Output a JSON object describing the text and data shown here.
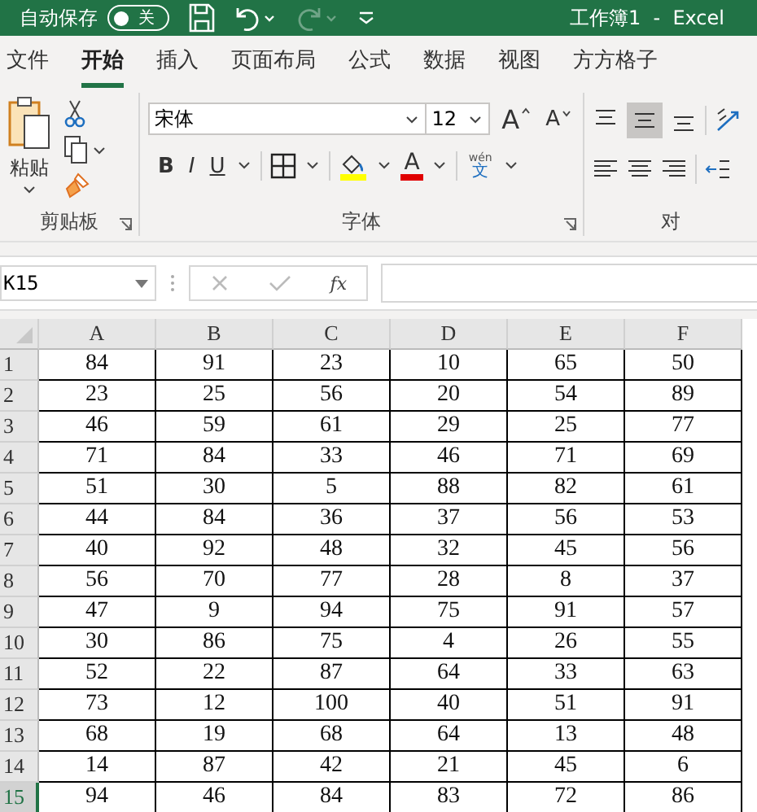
{
  "title_bar": {
    "autosave_label": "自动保存",
    "autosave_toggle": {
      "on": false,
      "label": "关"
    },
    "redo_disabled": true,
    "title": "工作簿1  -  Excel"
  },
  "tabs": [
    {
      "label": "文件",
      "selected": false
    },
    {
      "label": "开始",
      "selected": true
    },
    {
      "label": "插入",
      "selected": false
    },
    {
      "label": "页面布局",
      "selected": false
    },
    {
      "label": "公式",
      "selected": false
    },
    {
      "label": "数据",
      "selected": false
    },
    {
      "label": "视图",
      "selected": false
    },
    {
      "label": "方方格子",
      "selected": false
    }
  ],
  "ribbon": {
    "paste_label": "粘贴",
    "font_name": "宋体",
    "font_size": "12",
    "grow_font": "A",
    "shrink_font": "A",
    "bold": "B",
    "italic": "I",
    "underline": "U",
    "font_color": "A",
    "phonetic_top": "wén",
    "phonetic_bottom": "文",
    "groups": [
      "剪贴板",
      "字体",
      "对"
    ]
  },
  "formula_bar": {
    "name_box": "K15",
    "fx": "fx"
  },
  "sheet": {
    "columns": [
      "A",
      "B",
      "C",
      "D",
      "E",
      "F"
    ],
    "rows": [
      {
        "number": "1",
        "selected": false,
        "cells": [
          "84",
          "91",
          "23",
          "10",
          "65",
          "50"
        ]
      },
      {
        "number": "2",
        "selected": false,
        "cells": [
          "23",
          "25",
          "56",
          "20",
          "54",
          "89"
        ]
      },
      {
        "number": "3",
        "selected": false,
        "cells": [
          "46",
          "59",
          "61",
          "29",
          "25",
          "77"
        ]
      },
      {
        "number": "4",
        "selected": false,
        "cells": [
          "71",
          "84",
          "33",
          "46",
          "71",
          "69"
        ]
      },
      {
        "number": "5",
        "selected": false,
        "cells": [
          "51",
          "30",
          "5",
          "88",
          "82",
          "61"
        ]
      },
      {
        "number": "6",
        "selected": false,
        "cells": [
          "44",
          "84",
          "36",
          "37",
          "56",
          "53"
        ]
      },
      {
        "number": "7",
        "selected": false,
        "cells": [
          "40",
          "92",
          "48",
          "32",
          "45",
          "56"
        ]
      },
      {
        "number": "8",
        "selected": false,
        "cells": [
          "56",
          "70",
          "77",
          "28",
          "8",
          "37"
        ]
      },
      {
        "number": "9",
        "selected": false,
        "cells": [
          "47",
          "9",
          "94",
          "75",
          "91",
          "57"
        ]
      },
      {
        "number": "10",
        "selected": false,
        "cells": [
          "30",
          "86",
          "75",
          "4",
          "26",
          "55"
        ]
      },
      {
        "number": "11",
        "selected": false,
        "cells": [
          "52",
          "22",
          "87",
          "64",
          "33",
          "63"
        ]
      },
      {
        "number": "12",
        "selected": false,
        "cells": [
          "73",
          "12",
          "100",
          "40",
          "51",
          "91"
        ]
      },
      {
        "number": "13",
        "selected": false,
        "cells": [
          "68",
          "19",
          "68",
          "64",
          "13",
          "48"
        ]
      },
      {
        "number": "14",
        "selected": false,
        "cells": [
          "14",
          "87",
          "42",
          "21",
          "45",
          "6"
        ]
      },
      {
        "number": "15",
        "selected": true,
        "cells": [
          "94",
          "46",
          "84",
          "83",
          "72",
          "86"
        ]
      }
    ]
  }
}
